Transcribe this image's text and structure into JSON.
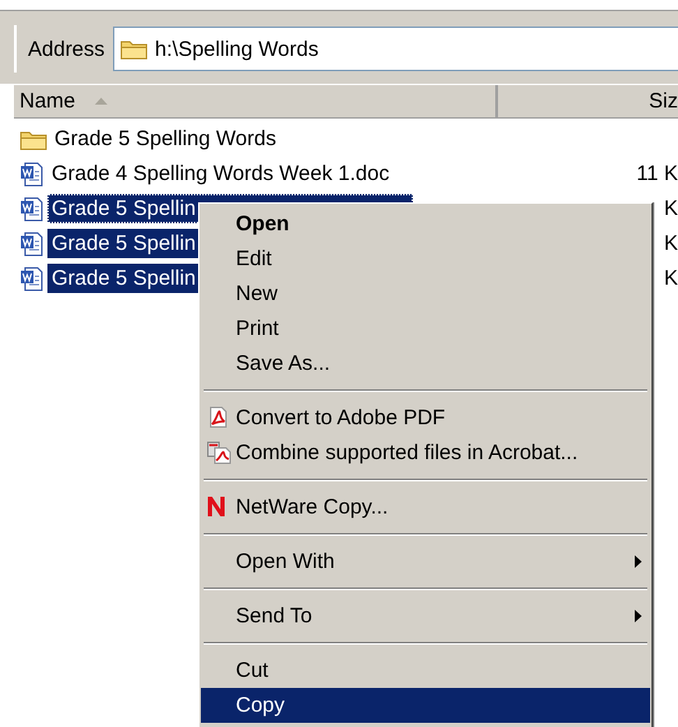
{
  "address_bar": {
    "label": "Address",
    "path": "h:\\Spelling Words"
  },
  "columns": [
    {
      "label": "Name",
      "sorted": true
    },
    {
      "label": "Siz",
      "sorted": false
    }
  ],
  "files": [
    {
      "kind": "folder",
      "name": "Grade 5 Spelling Words",
      "selected": false,
      "focused": false
    },
    {
      "kind": "document",
      "name": "Grade 4 Spelling Words Week 1.doc",
      "size": "11 K",
      "selected": false,
      "focused": false
    },
    {
      "kind": "document",
      "name": "Grade 5 Spellin",
      "size": "K",
      "selected": true,
      "focused": true
    },
    {
      "kind": "document",
      "name": "Grade 5 Spellin",
      "size": "K",
      "selected": true,
      "focused": false
    },
    {
      "kind": "document",
      "name": "Grade 5 Spellin",
      "size": "K",
      "selected": true,
      "focused": false
    }
  ],
  "context_menu": {
    "items": [
      {
        "kind": "item",
        "label": "Open",
        "default": true,
        "selected": false
      },
      {
        "kind": "item",
        "label": "Edit",
        "default": false,
        "selected": false
      },
      {
        "kind": "item",
        "label": "New",
        "default": false,
        "selected": false
      },
      {
        "kind": "item",
        "label": "Print",
        "default": false,
        "selected": false
      },
      {
        "kind": "item",
        "label": "Save As...",
        "default": false,
        "selected": false
      },
      {
        "kind": "separator"
      },
      {
        "kind": "pdf",
        "label": "Convert to Adobe PDF",
        "default": false,
        "selected": false
      },
      {
        "kind": "combine",
        "label": "Combine supported files in Acrobat...",
        "default": false,
        "selected": false
      },
      {
        "kind": "separator"
      },
      {
        "kind": "netware",
        "label": "NetWare Copy...",
        "default": false,
        "selected": false
      },
      {
        "kind": "separator"
      },
      {
        "kind": "submenu",
        "label": "Open With",
        "default": false,
        "selected": false
      },
      {
        "kind": "separator"
      },
      {
        "kind": "submenu",
        "label": "Send To",
        "default": false,
        "selected": false
      },
      {
        "kind": "separator"
      },
      {
        "kind": "item",
        "label": "Cut",
        "default": false,
        "selected": false
      },
      {
        "kind": "item",
        "label": "Copy",
        "default": false,
        "selected": true
      }
    ]
  }
}
